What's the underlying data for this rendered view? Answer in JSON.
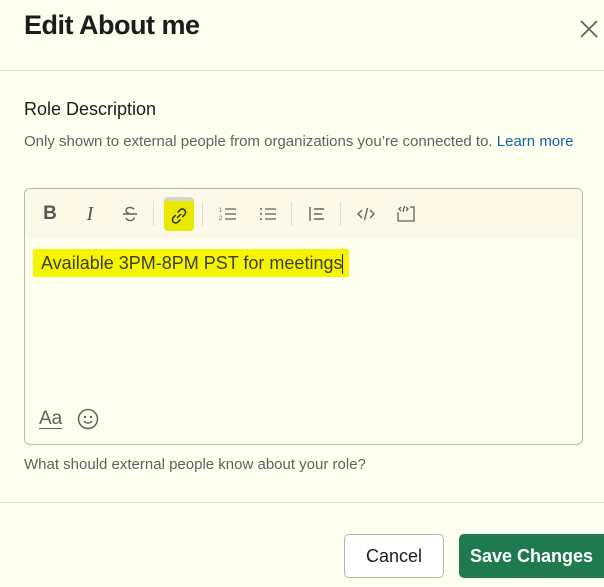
{
  "dialog": {
    "title": "Edit About me",
    "close_icon": "close-icon"
  },
  "field": {
    "label": "Role Description",
    "hint": "Only shown to external people from organizations you’re connected to.",
    "learn_more": "Learn more",
    "value": "Available 3PM-8PM PST for meetings",
    "help_text": "What should external people know about your role?"
  },
  "toolbar": {
    "bold": "B",
    "italic": "I",
    "format_label": "Aa",
    "items": [
      "bold",
      "italic",
      "strikethrough",
      "link",
      "ordered-list",
      "bulleted-list",
      "blockquote",
      "code",
      "code-block"
    ],
    "active": "link"
  },
  "footer": {
    "cancel_label": "Cancel",
    "save_label": "Save Changes"
  },
  "colors": {
    "primary": "#1f7a4f",
    "link": "#1264a3",
    "highlight": "#f5f500"
  }
}
